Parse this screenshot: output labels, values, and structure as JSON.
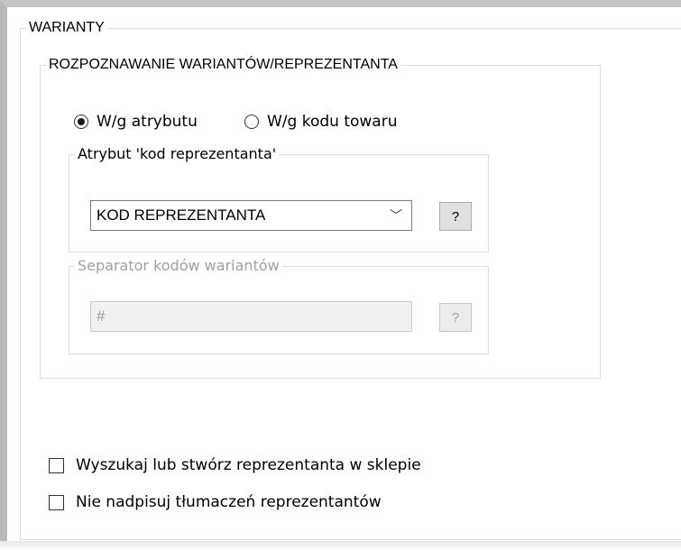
{
  "groups": {
    "warianty": "WARIANTY",
    "rozpoznawanie": "ROZPOZNAWANIE WARIANTÓW/REPREZENTANTA",
    "atrybut": "Atrybut 'kod reprezentanta'",
    "separator": "Separator kodów wariantów"
  },
  "radios": {
    "atrybutu": {
      "label": "W/g atrybutu",
      "selected": true
    },
    "kodu": {
      "label": "W/g kodu towaru",
      "selected": false
    }
  },
  "combo": {
    "value": "KOD REPREZENTANTA",
    "arrow": "﹀"
  },
  "help_button": {
    "label": "?"
  },
  "separator_input": {
    "value": "#"
  },
  "help_button_disabled": {
    "label": "?"
  },
  "checkboxes": {
    "wyszukaj": {
      "label": "Wyszukaj lub stwórz reprezentanta w sklepie",
      "checked": false
    },
    "nie_nadpisuj": {
      "label": "Nie nadpisuj tłumaczeń reprezentantów",
      "checked": false
    }
  }
}
